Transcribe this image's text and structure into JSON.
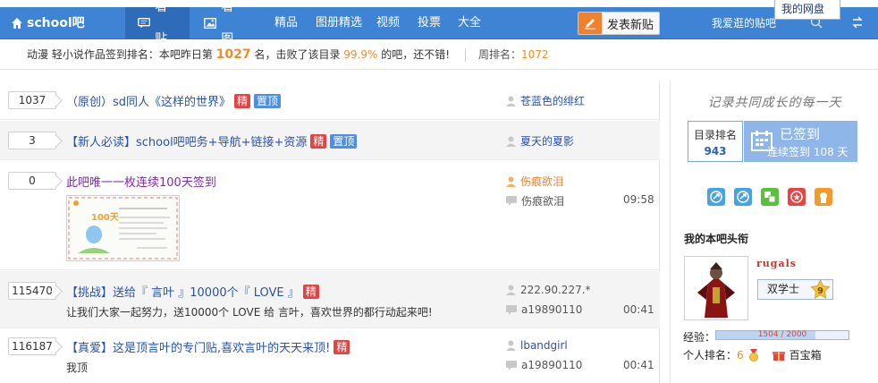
{
  "nav": {
    "brand": "school吧",
    "tabs": [
      {
        "label": "看贴"
      },
      {
        "label": "看图"
      }
    ],
    "links": [
      "精品",
      "图册精选",
      "视频",
      "投票",
      "大全"
    ],
    "post_button": "发表新贴",
    "fav": "我爱逛的贴吧",
    "popup": "我的网盘"
  },
  "signbar": {
    "prefix": "动漫 轻小说作品签到排名：本吧昨日第",
    "rank": "1027",
    "mid": "名，击败了该目录",
    "percent": "99.9%",
    "suffix": "的吧，还不错!",
    "week_label": "周排名：",
    "week_rank": "1072"
  },
  "threads": [
    {
      "count": "1037",
      "title": "（原创）sd同人《这样的世界》",
      "badges": [
        "精",
        "置顶"
      ],
      "author": "苍蓝色的绯红"
    },
    {
      "count": "3",
      "title": "【新人必读】school吧吧务+导航+链接+资源",
      "badges": [
        "精",
        "置顶"
      ],
      "author": "夏天的夏影"
    },
    {
      "count": "0",
      "title": "此吧唯一一枚连续100天签到",
      "author": "伤痕欲泪",
      "reply_user": "伤痕欲泪",
      "time": "09:58",
      "image_text": "100天"
    },
    {
      "count": "115470",
      "title": "【挑战】送给『 言叶 』10000个『 LOVE 』",
      "badges": [
        "精"
      ],
      "desc": "让我们大家一起努力，送10000个  LOVE 给  言叶，喜欢世界的都行动起来吧!",
      "author": "222.90.227.*",
      "reply_user": "a19890110",
      "time": "00:41"
    },
    {
      "count": "116187",
      "title": "【真爱】这是顶言叶的专门贴,喜欢言叶的天天来顶!",
      "badges": [
        "精"
      ],
      "desc": "我顶",
      "author": "lbandgirl",
      "reply_user": "a19890110",
      "time": "00:41"
    }
  ],
  "right": {
    "slogan": "记录共同成长的每一天",
    "rank_label": "目录排名",
    "rank_value": "943",
    "signed_label": "已签到",
    "signed_days": "连续签到  108 天",
    "section_title": "我的本吧头衔",
    "username": "rugals",
    "honor": "双学士",
    "level": "9",
    "exp_label": "经验：",
    "exp_text": "1504 / 2000",
    "exp_fraction": 0.752,
    "personal_rank_label": "个人排名：",
    "personal_rank": "6",
    "treasure": "百宝箱"
  },
  "colors": {
    "nav_bg": "#3f83d5",
    "accent_orange": "#f38b27",
    "link_blue": "#2a53a8",
    "badge_red": "#e04444",
    "badge_blue": "#4f8ee0"
  }
}
